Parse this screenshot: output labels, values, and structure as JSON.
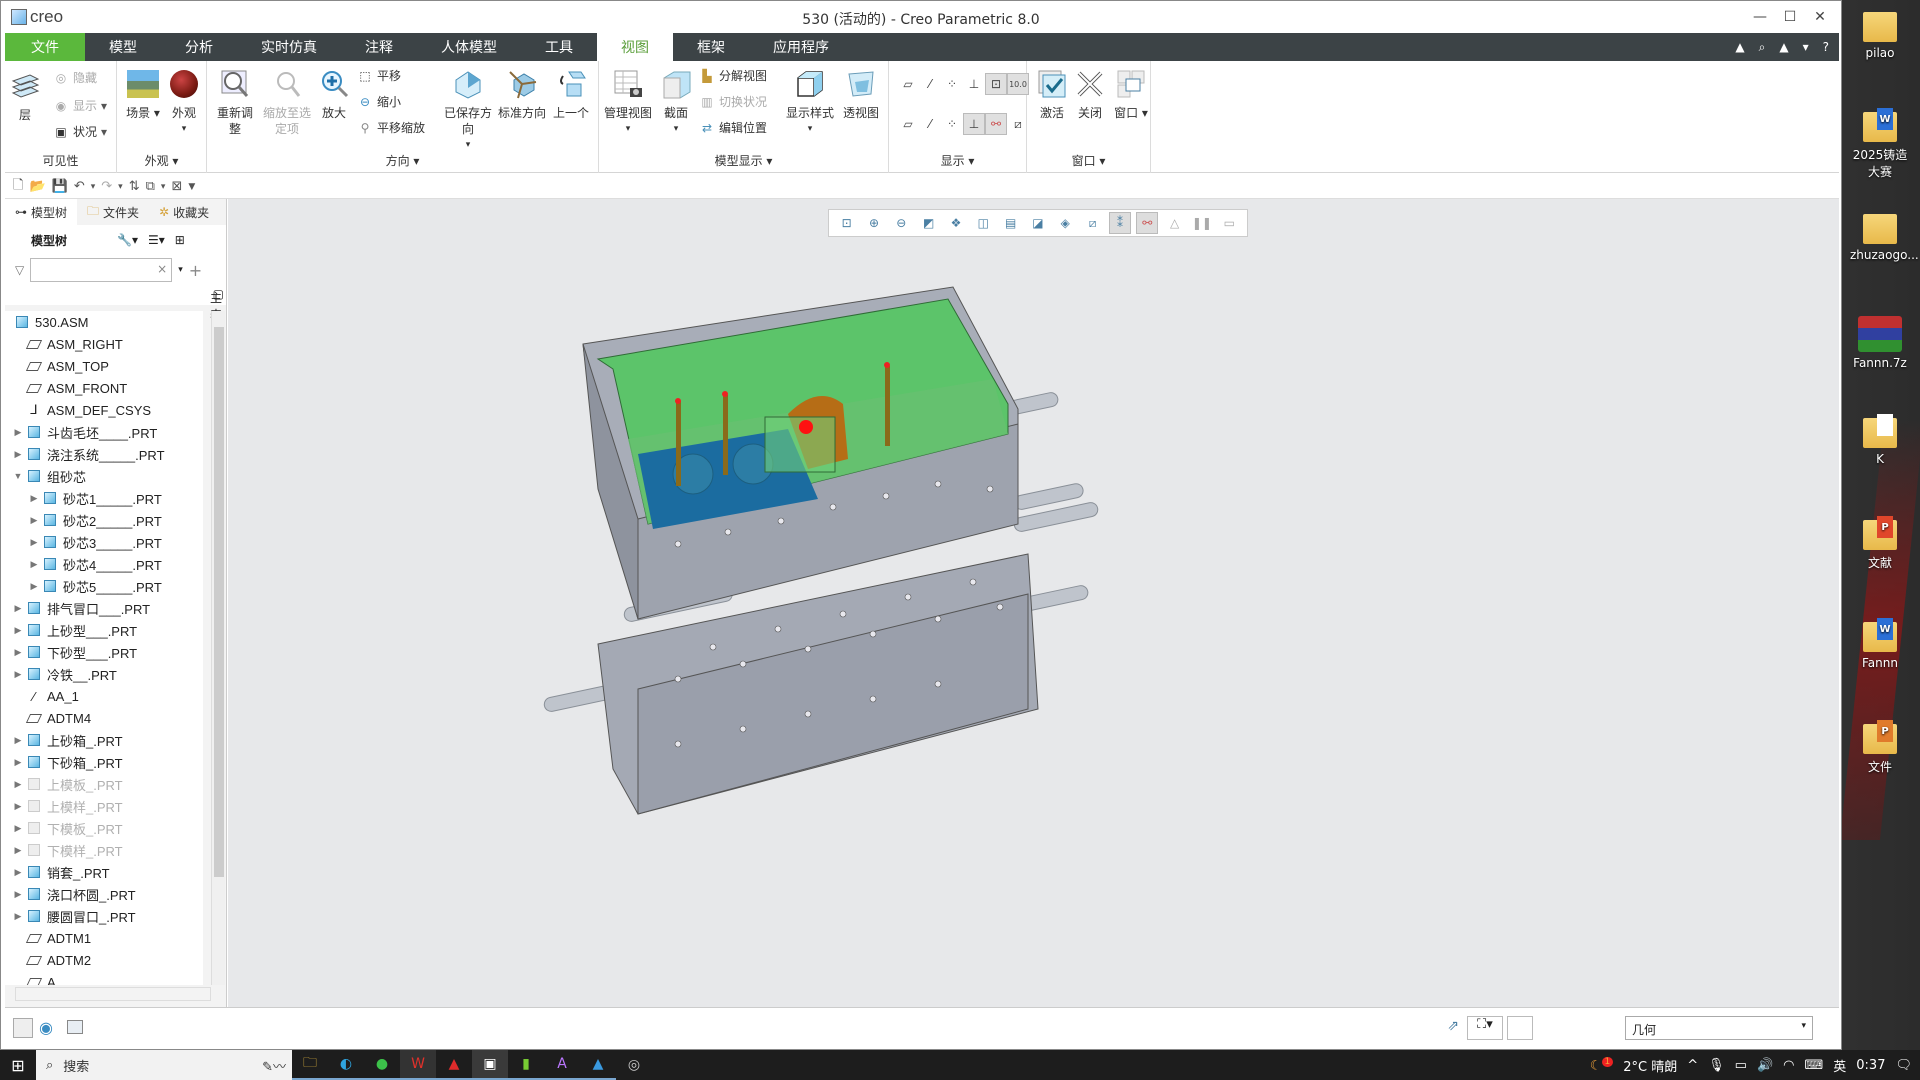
{
  "window": {
    "app_logo": "creo",
    "title": "530 (活动的) - Creo Parametric 8.0",
    "controls": {
      "minimize": "—",
      "maximize": "☐",
      "close": "✕"
    }
  },
  "menu": {
    "tabs": [
      "文件",
      "模型",
      "分析",
      "实时仿真",
      "注释",
      "人体模型",
      "工具",
      "视图",
      "框架",
      "应用程序"
    ],
    "active": "视图",
    "right_icons": [
      "collapse-ribbon-icon",
      "search-icon",
      "learning-icon",
      "dropdown-icon",
      "help-icon"
    ],
    "right_glyphs": [
      "▲",
      "⌕",
      "🎓",
      "▾",
      "?"
    ]
  },
  "ribbon": {
    "visibility": {
      "label": "可见性",
      "layer": "层",
      "hide": "隐藏",
      "show": "显示",
      "status": "状况"
    },
    "appearance": {
      "label": "外观",
      "scene": "场景",
      "appearance": "外观"
    },
    "orientation": {
      "label": "方向",
      "refit": "重新调整",
      "zoom_to_selected": "缩放至选定项",
      "zoom_in": "放大",
      "pan": "平移",
      "zoom_out": "缩小",
      "pan_zoom": "平移缩放",
      "saved_orientations": "已保存方向",
      "standard_orientation": "标准方向",
      "previous": "上一个"
    },
    "model_display": {
      "label": "模型显示",
      "manage_views": "管理视图",
      "section": "截面",
      "explode_view": "分解视图",
      "toggle_status": "切换状况",
      "edit_position": "编辑位置",
      "display_style": "显示样式",
      "perspective": "透视图"
    },
    "show": {
      "label": "显示",
      "row1": [
        "plane-display-icon",
        "axis-display-icon",
        "point-display-icon",
        "csys-display-icon",
        "annotation-display-icon",
        "dimension-display-icon"
      ],
      "row2": [
        "plane-tag-icon",
        "axis-tag-icon",
        "point-tag-icon",
        "csys-tag-icon",
        "spin-center-icon",
        "section-display-icon"
      ]
    },
    "window": {
      "label": "窗口",
      "activate": "激活",
      "close": "关闭",
      "windows": "窗口"
    }
  },
  "left_panel": {
    "tabs": [
      "模型树",
      "文件夹",
      "收藏夹"
    ],
    "tree_title": "模型树",
    "filter_placeholder": "",
    "column_header": "主表",
    "tree": [
      {
        "label": "530.ASM",
        "type": "asm",
        "level": 0,
        "expand": ""
      },
      {
        "label": "ASM_RIGHT",
        "type": "datum",
        "level": 1,
        "expand": ""
      },
      {
        "label": "ASM_TOP",
        "type": "datum",
        "level": 1,
        "expand": ""
      },
      {
        "label": "ASM_FRONT",
        "type": "datum",
        "level": 1,
        "expand": ""
      },
      {
        "label": "ASM_DEF_CSYS",
        "type": "csys",
        "level": 1,
        "expand": ""
      },
      {
        "label": "斗齿毛坯____.PRT",
        "type": "part",
        "level": 1,
        "expand": "▶"
      },
      {
        "label": "浇注系统_____.PRT",
        "type": "part",
        "level": 1,
        "expand": "▶"
      },
      {
        "label": "组砂芯",
        "type": "subasm",
        "level": 1,
        "expand": "▼"
      },
      {
        "label": "砂芯1_____.PRT",
        "type": "part",
        "level": 2,
        "expand": "▶"
      },
      {
        "label": "砂芯2_____.PRT",
        "type": "part",
        "level": 2,
        "expand": "▶"
      },
      {
        "label": "砂芯3_____.PRT",
        "type": "part",
        "level": 2,
        "expand": "▶"
      },
      {
        "label": "砂芯4_____.PRT",
        "type": "part",
        "level": 2,
        "expand": "▶"
      },
      {
        "label": "砂芯5_____.PRT",
        "type": "part",
        "level": 2,
        "expand": "▶"
      },
      {
        "label": "排气冒口___.PRT",
        "type": "part",
        "level": 1,
        "expand": "▶"
      },
      {
        "label": "上砂型___.PRT",
        "type": "part",
        "level": 1,
        "expand": "▶"
      },
      {
        "label": "下砂型___.PRT",
        "type": "part",
        "level": 1,
        "expand": "▶"
      },
      {
        "label": "冷铁__.PRT",
        "type": "part",
        "level": 1,
        "expand": "▶"
      },
      {
        "label": "AA_1",
        "type": "axis",
        "level": 1,
        "expand": ""
      },
      {
        "label": "ADTM4",
        "type": "datum",
        "level": 1,
        "expand": ""
      },
      {
        "label": "上砂箱_.PRT",
        "type": "part",
        "level": 1,
        "expand": "▶"
      },
      {
        "label": "下砂箱_.PRT",
        "type": "part",
        "level": 1,
        "expand": "▶"
      },
      {
        "label": "上模板_.PRT",
        "type": "part-hidden",
        "level": 1,
        "expand": "▶"
      },
      {
        "label": "上模样_.PRT",
        "type": "part-hidden",
        "level": 1,
        "expand": "▶"
      },
      {
        "label": "下模板_.PRT",
        "type": "part-hidden",
        "level": 1,
        "expand": "▶"
      },
      {
        "label": "下模样_.PRT",
        "type": "part-hidden",
        "level": 1,
        "expand": "▶"
      },
      {
        "label": "销套_.PRT",
        "type": "part",
        "level": 1,
        "expand": "▶"
      },
      {
        "label": "浇口杯圆_.PRT",
        "type": "part",
        "level": 1,
        "expand": "▶"
      },
      {
        "label": "腰圆冒口_.PRT",
        "type": "part",
        "level": 1,
        "expand": "▶"
      },
      {
        "label": "ADTM1",
        "type": "datum",
        "level": 1,
        "expand": ""
      },
      {
        "label": "ADTM2",
        "type": "datum",
        "level": 1,
        "expand": ""
      },
      {
        "label": "A",
        "type": "datum",
        "level": 1,
        "expand": ""
      }
    ]
  },
  "graphics_toolbar": [
    "refit-icon",
    "zoom-in-icon",
    "zoom-out-icon",
    "repaint-icon",
    "display-style-icon",
    "saved-orientations-icon",
    "view-manager-icon",
    "section-icon",
    "perspective-icon",
    "datum-display-icon",
    "annotation-display-icon",
    "spin-center-icon",
    "flip-icon",
    "pause-icon",
    "appearance-icon"
  ],
  "status_bar": {
    "left_icons": [
      "show-tree-icon",
      "browser-icon",
      "full-screen-icon"
    ],
    "selection_filter": "几何"
  },
  "desktop_icons": [
    {
      "label": "pilao",
      "badge": ""
    },
    {
      "label": "2025铸造大赛",
      "badge": "W"
    },
    {
      "label": "zhuzaogo...",
      "badge": ""
    },
    {
      "label": "Fannn.7z",
      "badge": "rar"
    },
    {
      "label": "K",
      "badge": ""
    },
    {
      "label": "文献",
      "badge": "P"
    },
    {
      "label": "Fannn",
      "badge": "W"
    },
    {
      "label": "文件",
      "badge": "P"
    }
  ],
  "taskbar": {
    "search_label": "搜索",
    "apps": [
      "file-explorer",
      "edge",
      "wechat",
      "wps",
      "autocad",
      "creo",
      "app-7",
      "app-8",
      "photos",
      "obs"
    ],
    "weather": "2°C 晴朗",
    "ime": "英",
    "time": "0:37",
    "notification_badge": "1"
  }
}
